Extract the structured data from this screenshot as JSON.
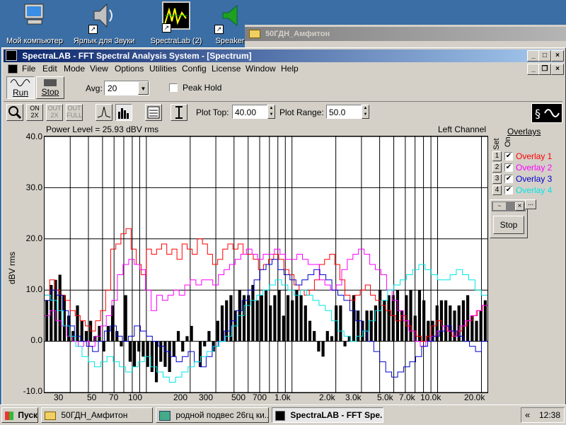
{
  "desktop": {
    "icons": [
      {
        "label": "Мой компьютер",
        "icon": "my-computer-icon"
      },
      {
        "label": "Ярлык для Звуки",
        "icon": "speaker-icon"
      },
      {
        "label": "SpectraLab (2)",
        "icon": "spectralab-icon"
      },
      {
        "label": "Speaker",
        "icon": "speaker-folder-icon"
      }
    ]
  },
  "background_window": {
    "title": "50ГДН_Амфитон"
  },
  "window": {
    "title": "SpectraLAB - FFT Spectral Analysis System - [Spectrum]",
    "menu": [
      "File",
      "Edit",
      "Mode",
      "View",
      "Options",
      "Utilities",
      "Config",
      "License",
      "Window",
      "Help"
    ],
    "toolbar": {
      "run_label": "Run",
      "stop_label": "Stop",
      "avg_label": "Avg:",
      "avg_value": "20",
      "peak_hold_label": "Peak Hold",
      "plot_top_label": "Plot Top:",
      "plot_top_value": "40.00",
      "plot_range_label": "Plot Range:",
      "plot_range_value": "50.0",
      "buttons": [
        "zoom-icon",
        "2x-on-icon",
        "2x-out-icon",
        "full-out-icon",
        "peak-icon",
        "bars-icon",
        "settings-icon",
        "scale-icon"
      ]
    }
  },
  "chart_header": {
    "power_level": "Power Level = 25.93 dBV rms",
    "channel": "Left Channel"
  },
  "overlays": {
    "title": "Overlays",
    "set_label": "Set",
    "on_label": "On",
    "items": [
      {
        "num": "1",
        "label": "Overlay 1",
        "color": "#ff0000",
        "checked": true
      },
      {
        "num": "2",
        "label": "Overlay 2",
        "color": "#ff00ff",
        "checked": true
      },
      {
        "num": "3",
        "label": "Overlay 3",
        "color": "#0000cc",
        "checked": true
      },
      {
        "num": "4",
        "label": "Overlay 4",
        "color": "#00e5e5",
        "checked": true
      }
    ],
    "mini_stop_label": "Stop"
  },
  "chart_data": {
    "type": "bar",
    "ylabel": "dBV rms",
    "y_axis": {
      "min": -10,
      "max": 40,
      "ticks": [
        "40.0",
        "30.0",
        "20.0",
        "10.0",
        "0.0",
        "-10.0"
      ]
    },
    "x_axis": {
      "scale": "log",
      "min": 20,
      "max": 22000,
      "tick_labels": [
        "30",
        "50",
        "70",
        "100",
        "200",
        "300",
        "500",
        "700",
        "1.0k",
        "2.0k",
        "3.0k",
        "5.0k",
        "7.0k",
        "10.0k",
        "20.0k"
      ]
    },
    "spectrum_db": [
      8,
      11,
      12,
      13,
      9,
      5,
      2,
      7,
      4,
      2,
      4,
      1,
      3,
      -2,
      3,
      7,
      2,
      -1,
      9,
      -4,
      -5,
      -2,
      -3,
      -5,
      -6,
      -8,
      -4,
      -5,
      -6,
      -3,
      2,
      -2,
      1,
      3,
      0,
      -5,
      -1,
      2,
      -2,
      4,
      7,
      8,
      9,
      6,
      10,
      9,
      9,
      11,
      8,
      9,
      10,
      7,
      9,
      10,
      5,
      9,
      8,
      10,
      9,
      7,
      4,
      2,
      -2,
      -3,
      2,
      1,
      7,
      7,
      -1,
      1,
      9,
      6,
      4,
      6,
      6,
      7,
      10,
      8,
      9,
      9,
      10,
      6,
      9,
      10,
      5,
      10,
      8,
      4,
      4,
      7,
      8,
      8,
      7,
      6,
      7,
      8,
      9,
      5,
      4,
      6,
      8
    ]
  },
  "taskbar": {
    "start_label": "Пуск",
    "tasks": [
      "50ГДН_Амфитон",
      "родной подвес 26гц ки...",
      "SpectraLAB - FFT Spe..."
    ],
    "clock": "12:38",
    "tray_arrows": "«"
  }
}
